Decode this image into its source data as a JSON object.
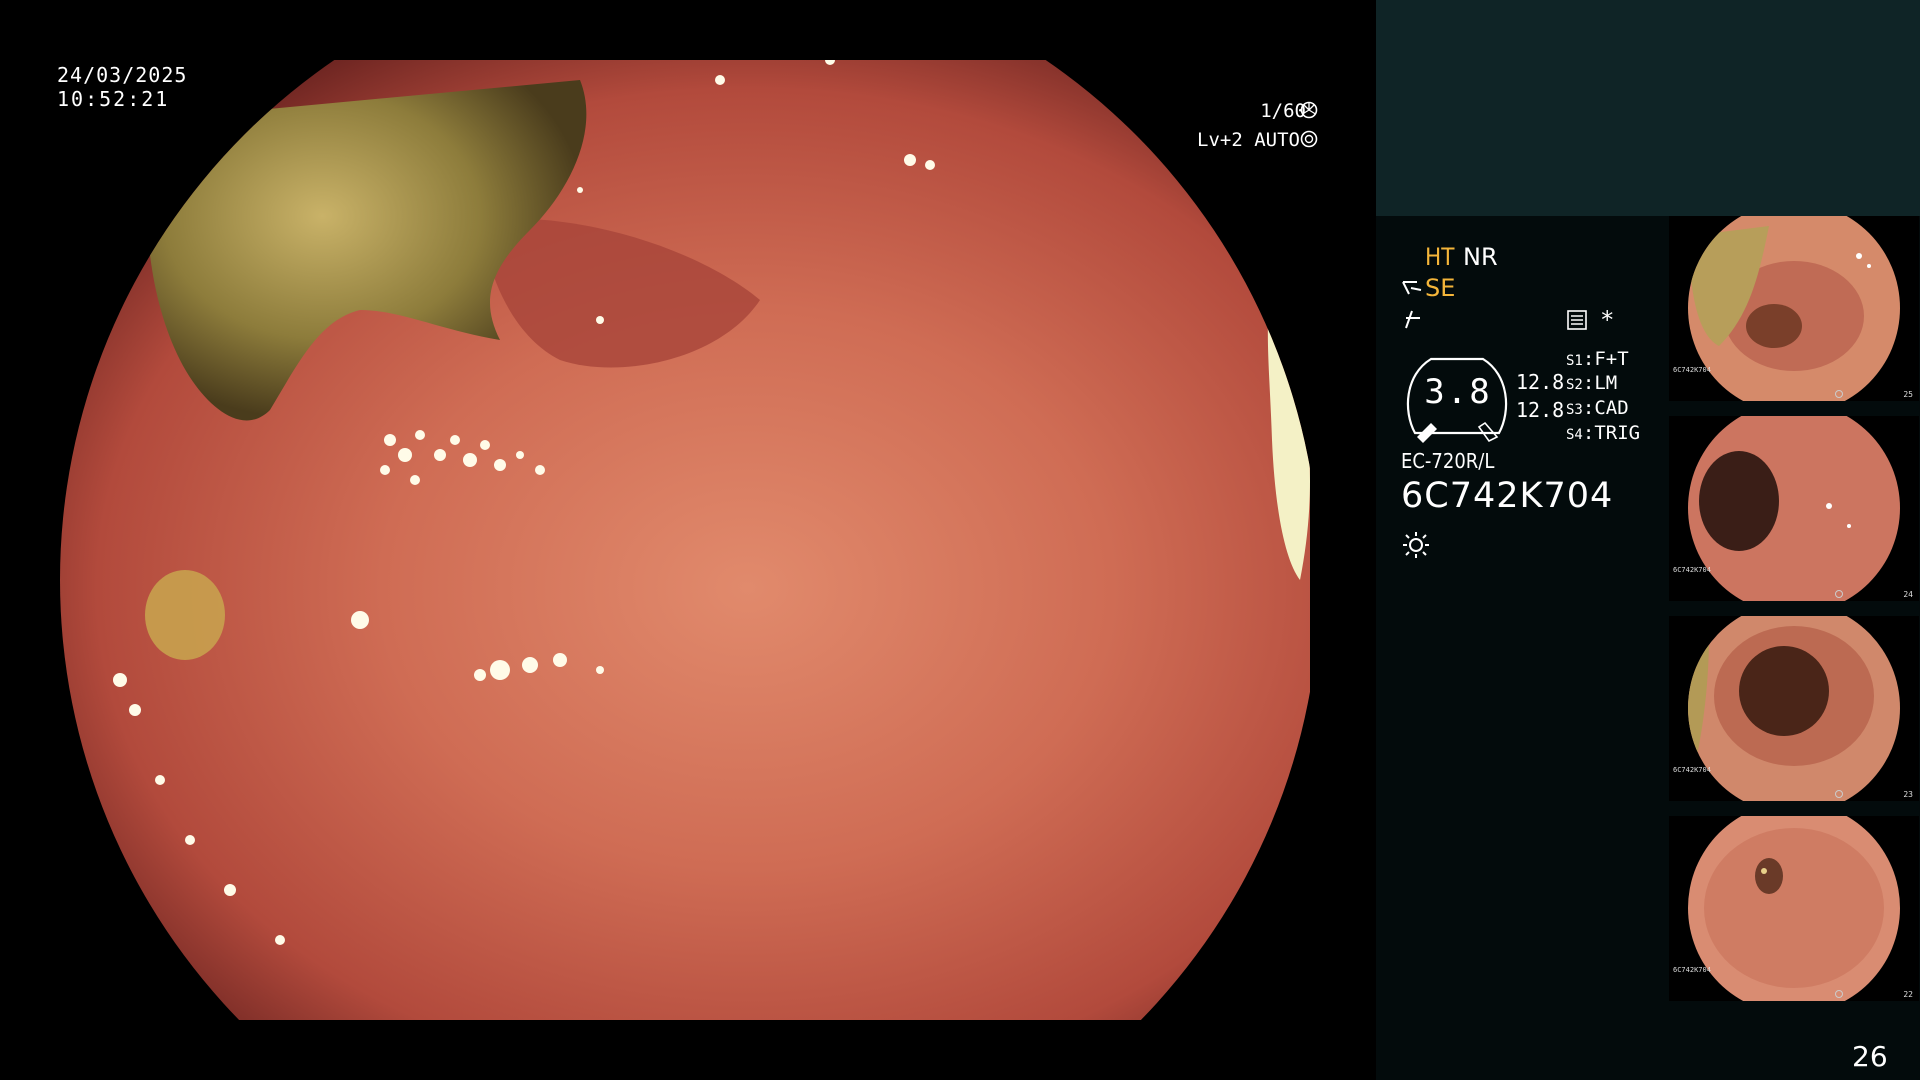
{
  "overlay": {
    "date": "24/03/2025",
    "time": "10:52:21",
    "shutter": "1/60",
    "level_mode": "Lv+2 AUTO"
  },
  "panel": {
    "ht": "HT",
    "nr": "NR",
    "se": "SE",
    "asterisk": "*",
    "dial_value": "3.8",
    "value_1": "12.8",
    "value_2": "12.8",
    "switches": [
      {
        "key": "S1",
        "value": "F+T"
      },
      {
        "key": "S2",
        "value": "LM"
      },
      {
        "key": "S3",
        "value": "CAD"
      },
      {
        "key": "S4",
        "value": "TRIG"
      }
    ],
    "scope_model": "EC-720R/L",
    "scope_serial": "6C742K704",
    "page_number": "26"
  },
  "thumbnails": [
    {
      "number": "25",
      "serial": "6C742K704"
    },
    {
      "number": "24",
      "serial": "6C742K704"
    },
    {
      "number": "23",
      "serial": "6C742K704"
    },
    {
      "number": "22",
      "serial": "6C742K704"
    }
  ],
  "icons": {
    "shutter": "shutter-icon",
    "auto": "auto-exposure-icon",
    "se": "se-mode-icon",
    "structure": "structure-enhance-icon",
    "memory": "memory-icon",
    "light": "light-icon"
  },
  "colors": {
    "mucosa": "#c85a45",
    "panel_top": "#0f2426",
    "panel": "#030b0c",
    "accent": "#f4b53a"
  }
}
